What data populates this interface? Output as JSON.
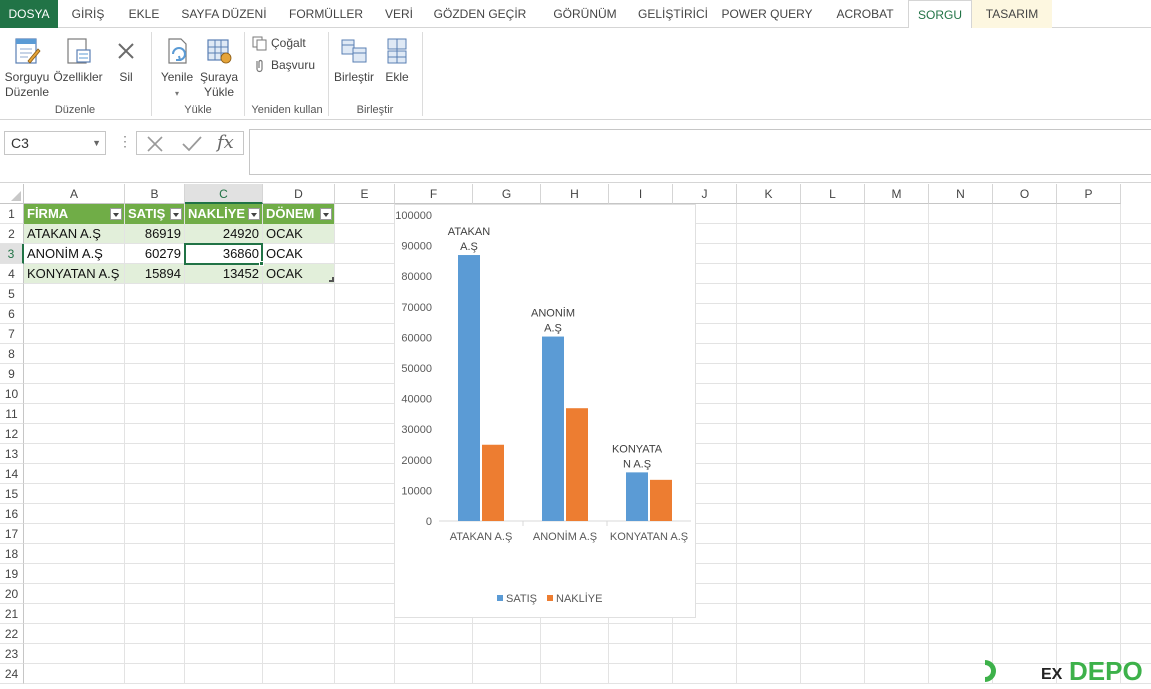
{
  "tabs": [
    {
      "label": "DOSYA",
      "type": "file"
    },
    {
      "label": "GİRİŞ"
    },
    {
      "label": "EKLE"
    },
    {
      "label": "SAYFA DÜZENİ"
    },
    {
      "label": "FORMÜLLER"
    },
    {
      "label": "VERİ"
    },
    {
      "label": "GÖZDEN GEÇİR"
    },
    {
      "label": "GÖRÜNÜM"
    },
    {
      "label": "GELİŞTİRİCİ"
    },
    {
      "label": "POWER QUERY"
    },
    {
      "label": "ACROBAT"
    },
    {
      "label": "SORGU",
      "type": "active"
    },
    {
      "label": "TASARIM",
      "type": "ctx"
    }
  ],
  "ribbon": {
    "groups": {
      "duzenle": {
        "label": "Düzenle",
        "sorguyu_duzenle_1": "Sorguyu",
        "sorguyu_duzenle_2": "Düzenle",
        "ozellikler": "Özellikler",
        "sil": "Sil"
      },
      "yukle": {
        "label": "Yükle",
        "yenile": "Yenile",
        "suraya_yukle_1": "Şuraya",
        "suraya_yukle_2": "Yükle"
      },
      "yeniden_kullan": {
        "label": "Yeniden kullan",
        "cogalt": "Çoğalt",
        "basvuru": "Başvuru"
      },
      "birlestir": {
        "label": "Birleştir",
        "birlestir": "Birleştir",
        "ekle": "Ekle"
      }
    }
  },
  "formula_bar": {
    "name_box": "C3",
    "fx_symbol": "fx",
    "content": ""
  },
  "columns": [
    "A",
    "B",
    "C",
    "D",
    "E",
    "F",
    "G",
    "H",
    "I",
    "J",
    "K",
    "L",
    "M",
    "N",
    "O",
    "P"
  ],
  "rows": [
    "1",
    "2",
    "3",
    "4",
    "5",
    "6",
    "7",
    "8",
    "9",
    "10",
    "11",
    "12",
    "13",
    "14",
    "15",
    "16",
    "17",
    "18",
    "19",
    "20",
    "21",
    "22",
    "23",
    "24"
  ],
  "table": {
    "headers": [
      "FİRMA",
      "SATIŞ",
      "NAKLİYE",
      "DÖNEM"
    ],
    "rows": [
      [
        "ATAKAN A.Ş",
        "86919",
        "24920",
        "OCAK"
      ],
      [
        "ANONİM A.Ş",
        "60279",
        "36860",
        "OCAK"
      ],
      [
        "KONYATAN A.Ş",
        "15894",
        "13452",
        "OCAK"
      ]
    ],
    "header_color": "#70ad47",
    "band_color": "#e2efda"
  },
  "selected_cell": "C3",
  "chart_data": {
    "type": "bar",
    "categories": [
      "ATAKAN A.Ş",
      "ANONİM A.Ş",
      "KONYATAN A.Ş"
    ],
    "series": [
      {
        "name": "SATIŞ",
        "values": [
          86919,
          60279,
          15894
        ],
        "color": "#5b9bd5"
      },
      {
        "name": "NAKLİYE",
        "values": [
          24920,
          36860,
          13452
        ],
        "color": "#ed7d31"
      }
    ],
    "data_labels": [
      [
        "ATAKAN",
        "A.Ş"
      ],
      [
        "ANONİM",
        "A.Ş"
      ],
      [
        "KONYATA",
        "N A.Ş"
      ]
    ],
    "ylim": [
      0,
      100000
    ],
    "yticks": [
      "0",
      "10000",
      "20000",
      "30000",
      "40000",
      "50000",
      "60000",
      "70000",
      "80000",
      "90000",
      "100000"
    ],
    "legend_position": "bottom",
    "grid": false,
    "title": ""
  },
  "watermark": {
    "text_1": "EX",
    "text_2": "DEPO"
  }
}
